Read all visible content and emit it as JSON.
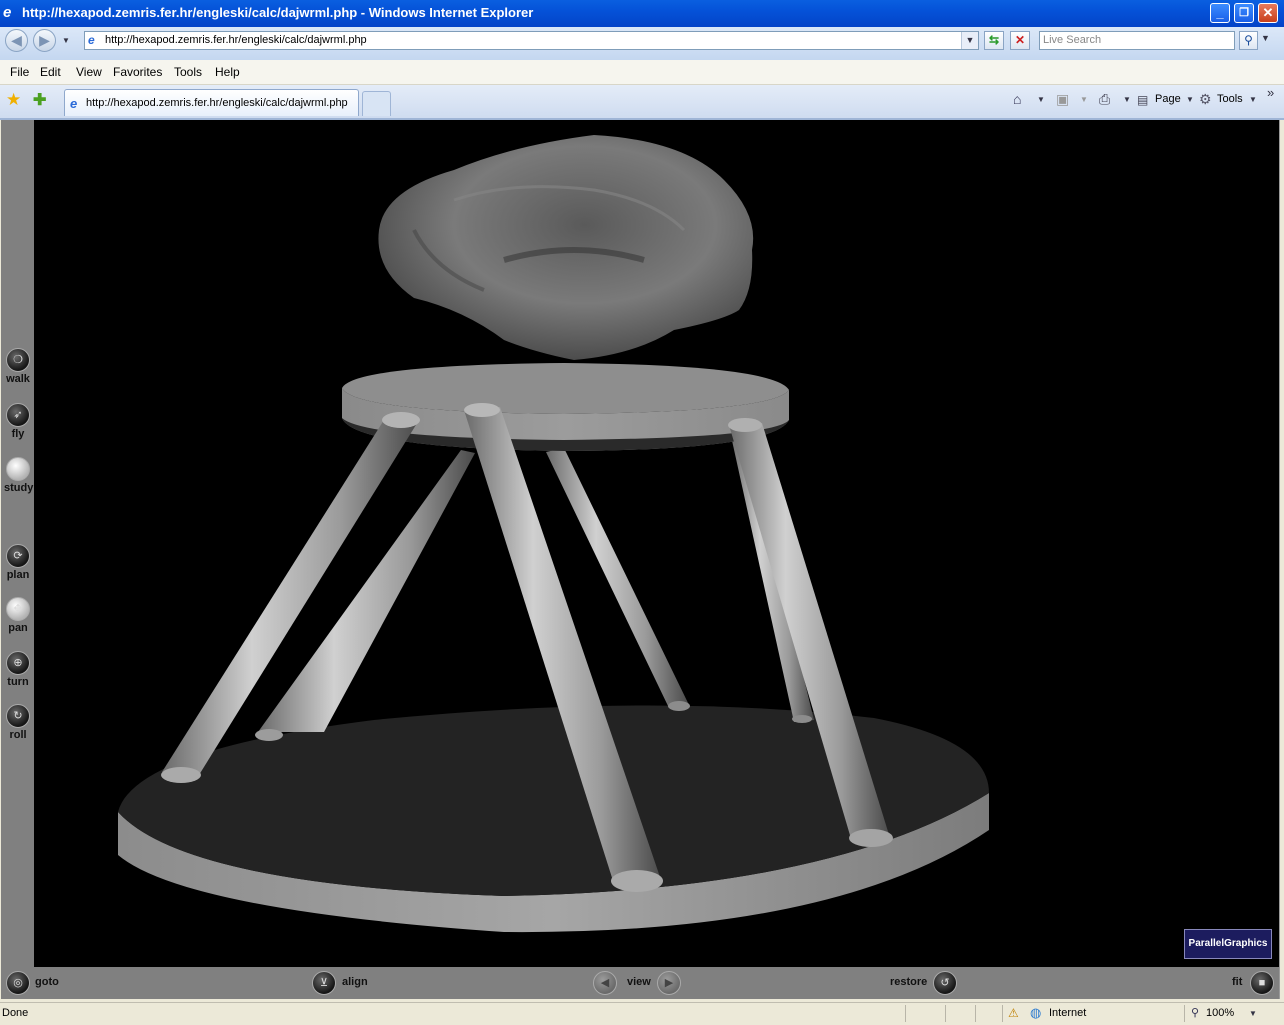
{
  "window": {
    "title": "http://hexapod.zemris.fer.hr/engleski/calc/dajwrml.php - Windows Internet Explorer",
    "buttons": {
      "minimize": "_",
      "restore": "❐",
      "close": "✕"
    }
  },
  "address_bar": {
    "url": "http://hexapod.zemris.fer.hr/engleski/calc/dajwrml.php",
    "search_placeholder": "Live Search"
  },
  "menu": [
    "File",
    "Edit",
    "View",
    "Favorites",
    "Tools",
    "Help"
  ],
  "tab": {
    "label": "http://hexapod.zemris.fer.hr/engleski/calc/dajwrml.php"
  },
  "command_bar": {
    "page_label": "Page",
    "tools_label": "Tools",
    "overflow": "»"
  },
  "vrml_nav": {
    "left_tools": [
      {
        "label": "walk",
        "glyph": "❍"
      },
      {
        "label": "fly",
        "glyph": "➶"
      },
      {
        "label": "study",
        "glyph": ""
      },
      {
        "label": "plan",
        "glyph": "⟳"
      },
      {
        "label": "pan",
        "glyph": "✥"
      },
      {
        "label": "turn",
        "glyph": "⊕"
      },
      {
        "label": "roll",
        "glyph": "↻"
      }
    ],
    "bottom": {
      "goto": "goto",
      "align": "align",
      "view": "view",
      "restore": "restore",
      "fit": "fit"
    },
    "logo": "ParallelGraphics"
  },
  "colors": {
    "title_bar": "#0552d8",
    "viewport_bg": "#000000",
    "vrml_panel": "#808080"
  },
  "status": {
    "text": "Done",
    "zone": "Internet",
    "zoom": "100%"
  }
}
